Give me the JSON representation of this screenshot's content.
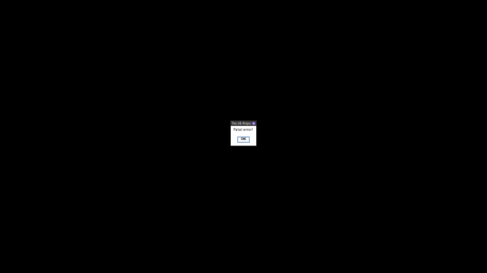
{
  "dialog": {
    "title": "The UE-Project...",
    "message": "Fatal error!",
    "ok_label": "OK",
    "close_icon": "close-icon"
  },
  "colors": {
    "background": "#000000",
    "titlebar": "#3a3a3a",
    "close_button": "#7b5cc7",
    "ok_border": "#7ea0c4"
  }
}
